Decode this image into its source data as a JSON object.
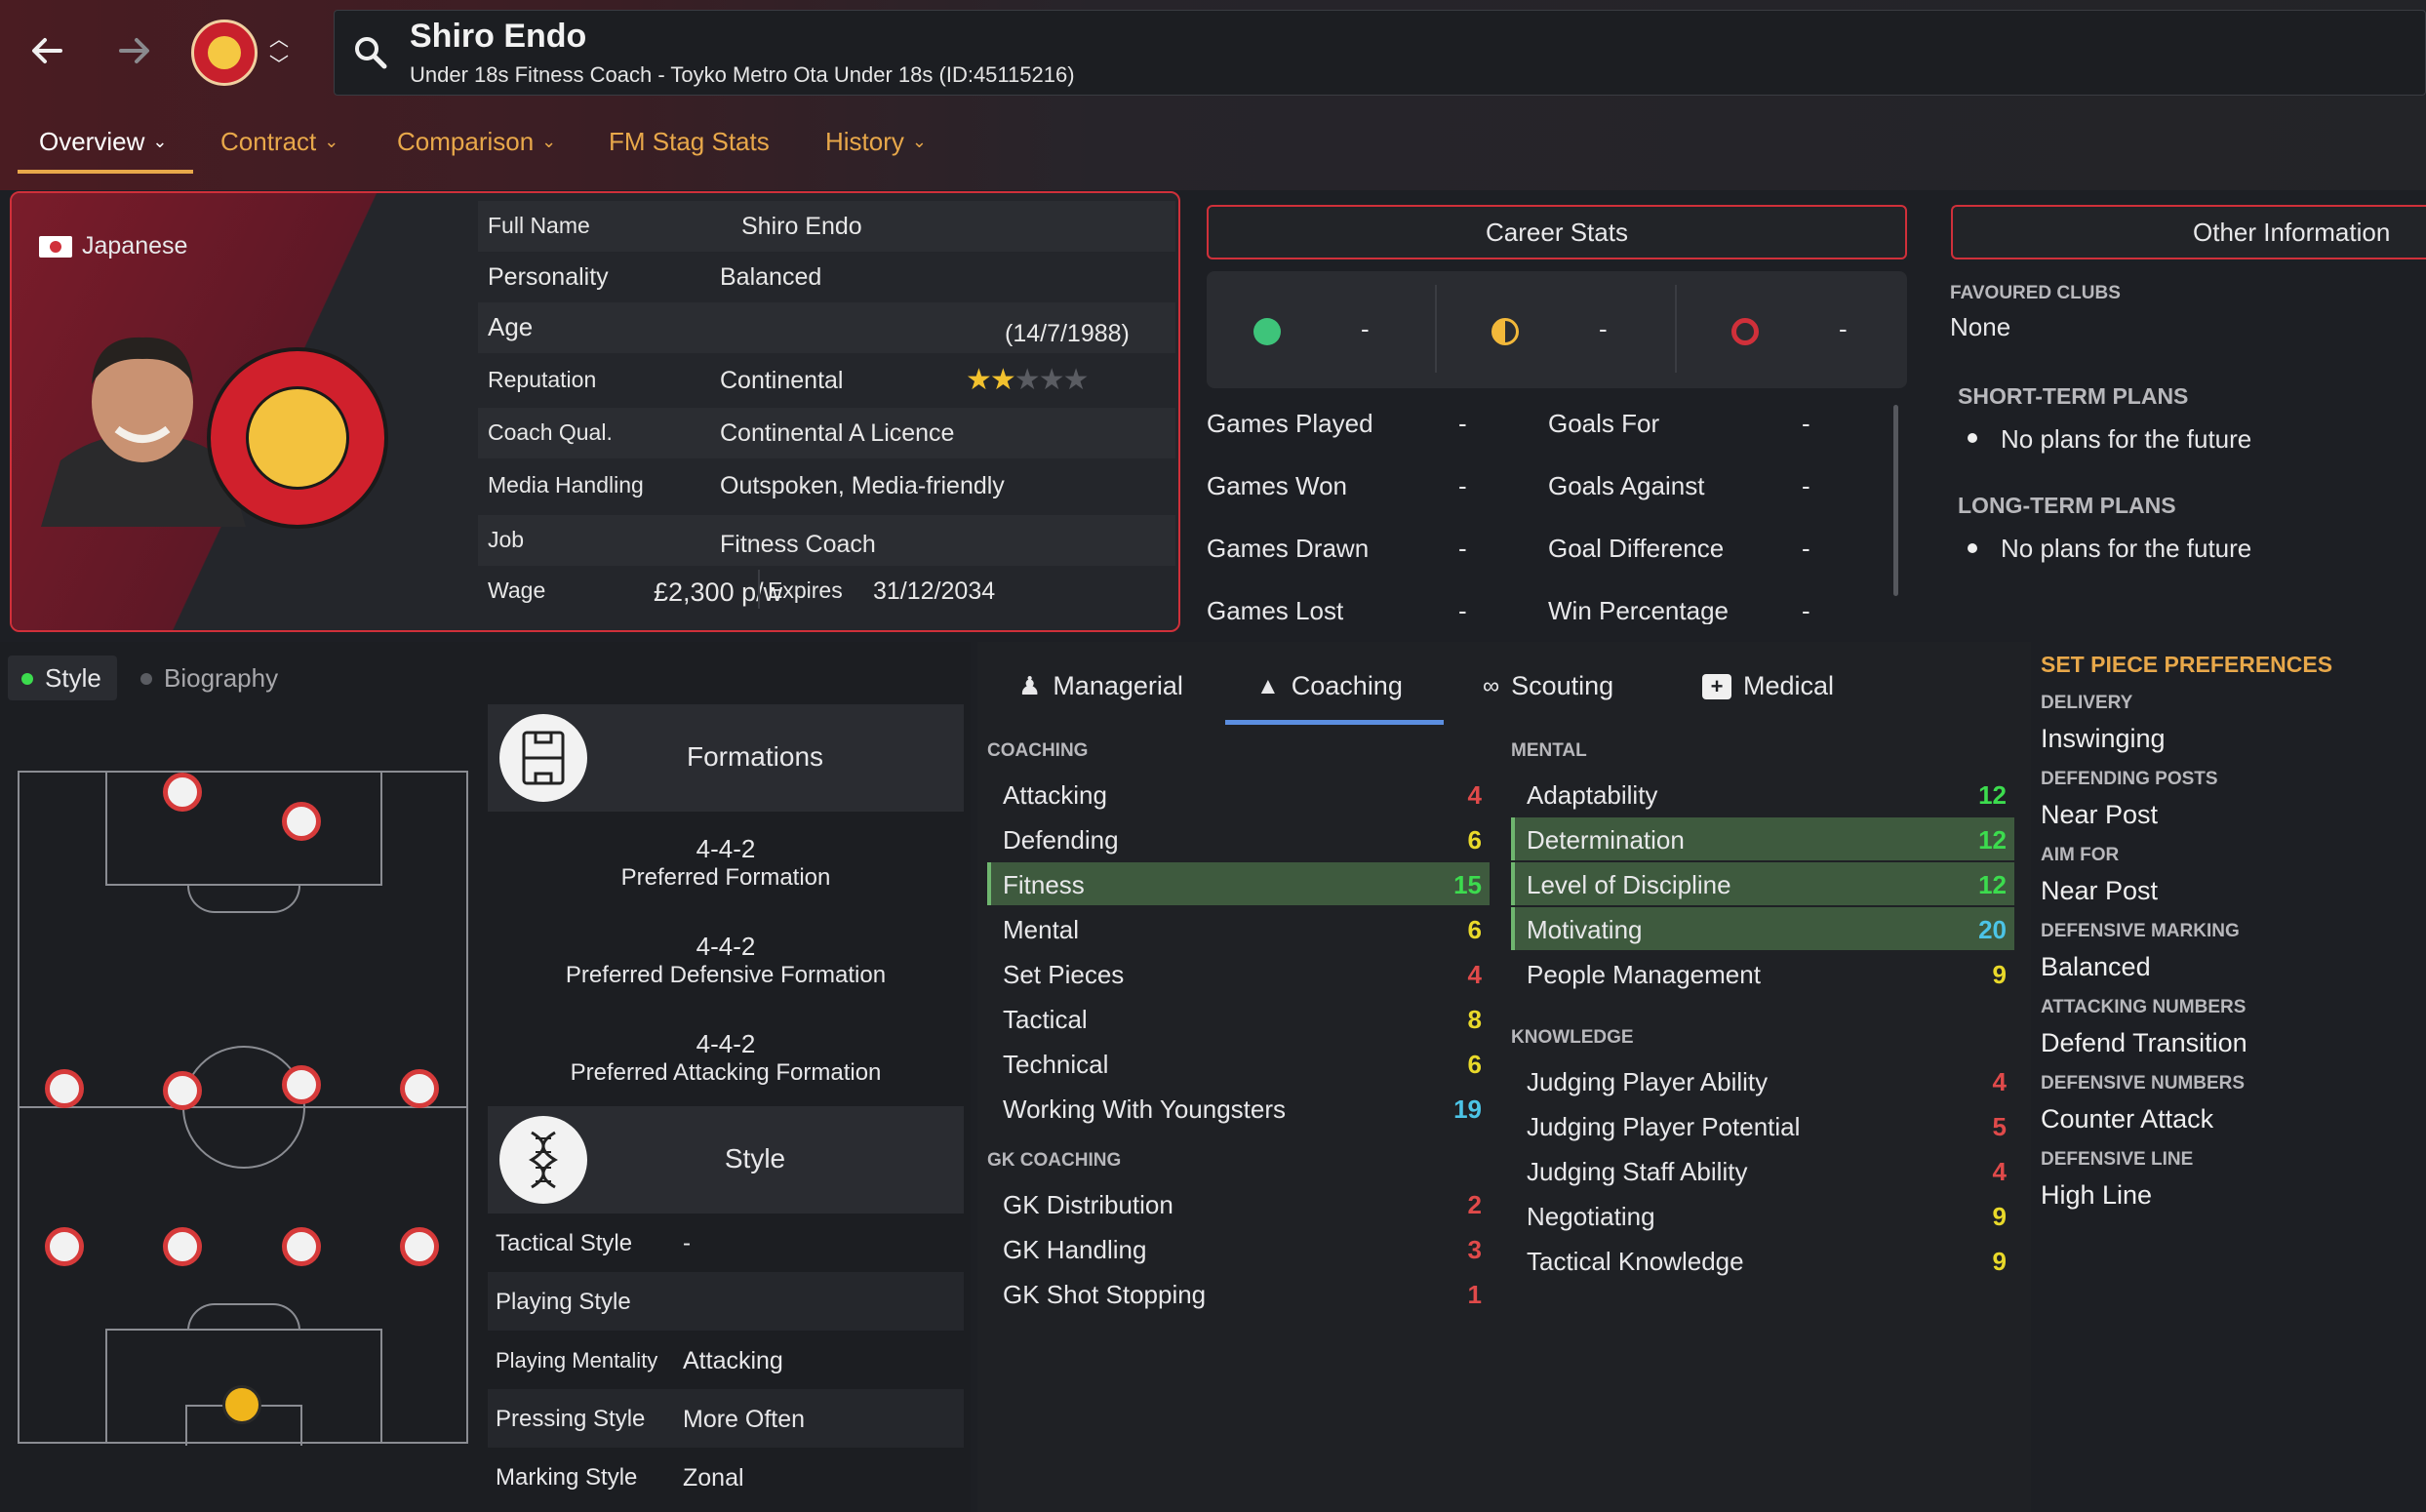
{
  "header": {
    "name": "Shiro Endo",
    "subtitle": "Under 18s Fitness Coach - Toyko Metro Ota Under 18s (ID:45115216)",
    "tabs": [
      "Overview",
      "Contract",
      "Comparison",
      "FM Stag Stats",
      "History"
    ]
  },
  "profile": {
    "nationality": "Japanese",
    "rows": [
      {
        "label": "Full Name",
        "value": "Shiro Endo"
      },
      {
        "label": "Personality",
        "value": "Balanced"
      },
      {
        "label": "Age",
        "value": "(14/7/1988)"
      },
      {
        "label": "Reputation",
        "value": "Continental"
      },
      {
        "label": "Coach Qual.",
        "value": "Continental A Licence"
      },
      {
        "label": "Media Handling",
        "value": "Outspoken, Media-friendly"
      },
      {
        "label": "Job",
        "value": "Fitness Coach"
      },
      {
        "label": "Wage",
        "value": "£2,300 p/w"
      }
    ],
    "expires_label": "Expires",
    "expires_value": "31/12/2034",
    "reputation_stars": 2,
    "reputation_max": 5
  },
  "career": {
    "title": "Career Stats",
    "summary": [
      "-",
      "-",
      "-"
    ],
    "left": [
      {
        "label": "Games Played",
        "value": "-"
      },
      {
        "label": "Games Won",
        "value": "-"
      },
      {
        "label": "Games Drawn",
        "value": "-"
      },
      {
        "label": "Games Lost",
        "value": "-"
      }
    ],
    "right": [
      {
        "label": "Goals For",
        "value": "-"
      },
      {
        "label": "Goals Against",
        "value": "-"
      },
      {
        "label": "Goal Difference",
        "value": "-"
      },
      {
        "label": "Win Percentage",
        "value": "-"
      }
    ]
  },
  "other": {
    "title": "Other Information",
    "favoured_label": "FAVOURED CLUBS",
    "favoured_value": "None",
    "short_label": "SHORT-TERM PLANS",
    "short_value": "No plans for the future",
    "long_label": "LONG-TERM PLANS",
    "long_value": "No plans for the future"
  },
  "style_tabs": [
    "Style",
    "Biography"
  ],
  "formations": {
    "title": "Formations",
    "items": [
      {
        "f": "4-4-2",
        "d": "Preferred Formation"
      },
      {
        "f": "4-4-2",
        "d": "Preferred Defensive Formation"
      },
      {
        "f": "4-4-2",
        "d": "Preferred Attacking Formation"
      }
    ]
  },
  "style": {
    "title": "Style",
    "rows": [
      {
        "label": "Tactical Style",
        "value": "-"
      },
      {
        "label": "Playing Style",
        "value": ""
      },
      {
        "label": "Playing Mentality",
        "value": "Attacking"
      },
      {
        "label": "Pressing Style",
        "value": "More Often"
      },
      {
        "label": "Marking Style",
        "value": "Zonal"
      }
    ]
  },
  "attr_tabs": [
    "Managerial",
    "Coaching",
    "Scouting",
    "Medical"
  ],
  "coaching": {
    "heading": "COACHING",
    "items": [
      {
        "n": "Attacking",
        "v": "4"
      },
      {
        "n": "Defending",
        "v": "6"
      },
      {
        "n": "Fitness",
        "v": "15"
      },
      {
        "n": "Mental",
        "v": "6"
      },
      {
        "n": "Set Pieces",
        "v": "4"
      },
      {
        "n": "Tactical",
        "v": "8"
      },
      {
        "n": "Technical",
        "v": "6"
      },
      {
        "n": "Working With Youngsters",
        "v": "19"
      }
    ]
  },
  "gk": {
    "heading": "GK COACHING",
    "items": [
      {
        "n": "GK Distribution",
        "v": "2"
      },
      {
        "n": "GK Handling",
        "v": "3"
      },
      {
        "n": "GK Shot Stopping",
        "v": "1"
      }
    ]
  },
  "mental": {
    "heading": "MENTAL",
    "items": [
      {
        "n": "Adaptability",
        "v": "12"
      },
      {
        "n": "Determination",
        "v": "12"
      },
      {
        "n": "Level of Discipline",
        "v": "12"
      },
      {
        "n": "Motivating",
        "v": "20"
      },
      {
        "n": "People Management",
        "v": "9"
      }
    ]
  },
  "knowledge": {
    "heading": "KNOWLEDGE",
    "items": [
      {
        "n": "Judging Player Ability",
        "v": "4"
      },
      {
        "n": "Judging Player Potential",
        "v": "5"
      },
      {
        "n": "Judging Staff Ability",
        "v": "4"
      },
      {
        "n": "Negotiating",
        "v": "9"
      },
      {
        "n": "Tactical Knowledge",
        "v": "9"
      }
    ]
  },
  "setpiece": {
    "title": "SET PIECE PREFERENCES",
    "items": [
      {
        "h": "DELIVERY",
        "v": "Inswinging"
      },
      {
        "h": "DEFENDING POSTS",
        "v": "Near Post"
      },
      {
        "h": "AIM FOR",
        "v": "Near Post"
      },
      {
        "h": "DEFENSIVE MARKING",
        "v": "Balanced"
      },
      {
        "h": "ATTACKING NUMBERS",
        "v": "Defend Transition"
      },
      {
        "h": "DEFENSIVE NUMBERS",
        "v": "Counter Attack"
      },
      {
        "h": "DEFENSIVE LINE",
        "v": "High Line"
      }
    ]
  },
  "colors": {
    "accent": "#e8a84a",
    "red": "#d0303a",
    "highlight": "#3e5a3e"
  }
}
